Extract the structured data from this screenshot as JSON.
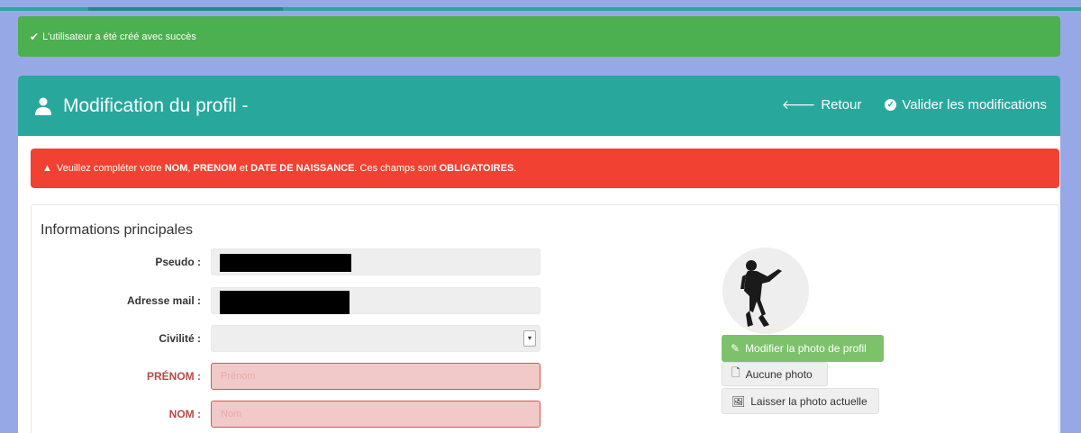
{
  "success_alert": {
    "icon": "check-icon",
    "message": "L'utilisateur a été créé avec succès"
  },
  "header": {
    "title": "Modification du profil -",
    "icon": "user-icon",
    "back_label": "Retour",
    "validate_label": "Valider les modifications"
  },
  "error_alert": {
    "icon": "warning-icon",
    "part1": "Veuillez compléter votre ",
    "nom": "NOM",
    "sep1": ", ",
    "prenom": "PRENOM",
    "sep2": " et ",
    "date": "DATE DE NAISSANCE",
    "part2": ". Ces champs sont ",
    "obligatoires": "OBLIGATOIRES",
    "part3": "."
  },
  "form": {
    "section_title": "Informations principales",
    "pseudo_label": "Pseudo :",
    "email_label": "Adresse mail :",
    "civilite_label": "Civilité :",
    "civilite_value": "",
    "prenom_label": "PRÉNOM :",
    "prenom_placeholder": "Prénom",
    "nom_label": "NOM :",
    "nom_placeholder": "Nom"
  },
  "photo": {
    "modify_label": "Modifier la photo de profil",
    "none_label": "Aucune photo",
    "keep_label": "Laisser la photo actuelle"
  },
  "colors": {
    "teal": "#28a89d",
    "success": "#4caf50",
    "danger": "#f04133",
    "background": "#97a8e6"
  }
}
